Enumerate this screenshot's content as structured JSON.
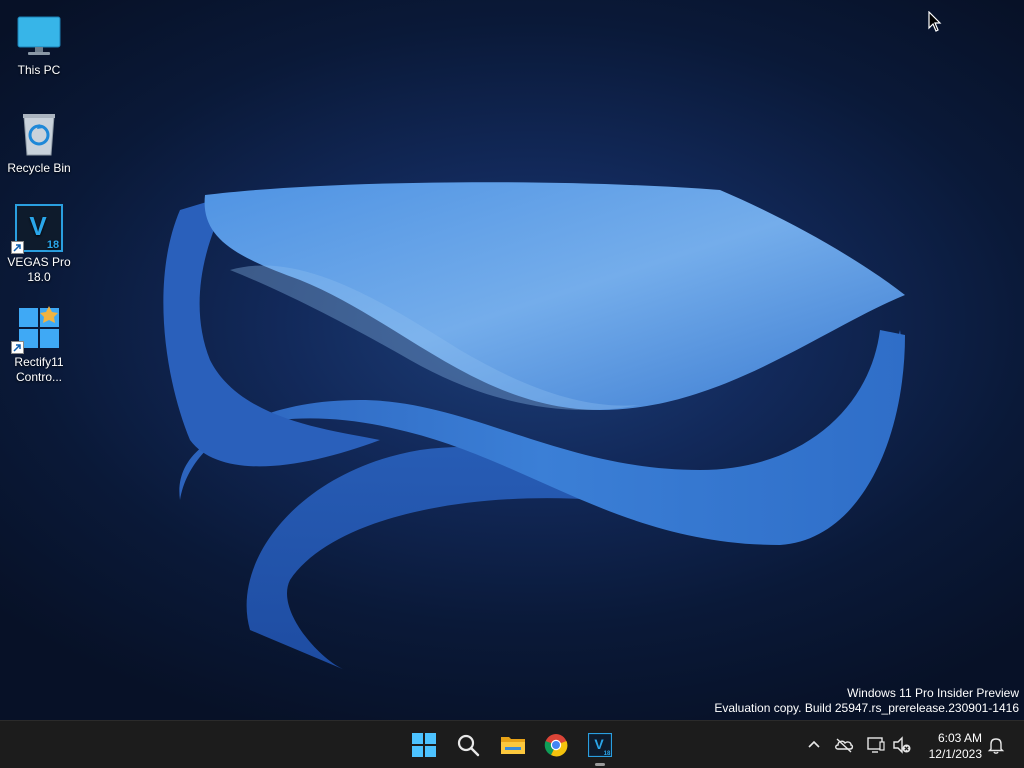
{
  "desktop": {
    "icons": [
      {
        "label": "This PC",
        "icon": "monitor-icon"
      },
      {
        "label": "Recycle Bin",
        "icon": "recycle-bin-icon"
      },
      {
        "label": "VEGAS Pro 18.0",
        "icon": "vegas-pro-icon",
        "glyph_letter": "V",
        "glyph_number": "18"
      },
      {
        "label": "Rectify11 Contro...",
        "icon": "control-panel-icon"
      }
    ]
  },
  "watermark": {
    "line1": "Windows 11 Pro Insider Preview",
    "line2": "Evaluation copy. Build 25947.rs_prerelease.230901-1416"
  },
  "taskbar": {
    "apps": [
      {
        "name": "Start",
        "icon": "windows-start-icon"
      },
      {
        "name": "Search",
        "icon": "search-icon"
      },
      {
        "name": "File Explorer",
        "icon": "folder-icon"
      },
      {
        "name": "Google Chrome",
        "icon": "chrome-icon"
      },
      {
        "name": "VEGAS Pro 18.0",
        "icon": "vegas-pro-icon",
        "glyph_letter": "V",
        "glyph_number": "18",
        "active": true
      }
    ],
    "tray": {
      "icons": [
        "chevron-up-icon",
        "onedrive-offline-icon",
        "network-icon",
        "speaker-muted-icon"
      ],
      "time": "6:03 AM",
      "date": "12/1/2023",
      "notification_icon": "bell-icon"
    }
  },
  "colors": {
    "accent": "#3b8cd8",
    "taskbar": "#1c1c1c",
    "wallpaper_dark": "#0a1938",
    "bloom_blue": "#3a7fd5"
  }
}
